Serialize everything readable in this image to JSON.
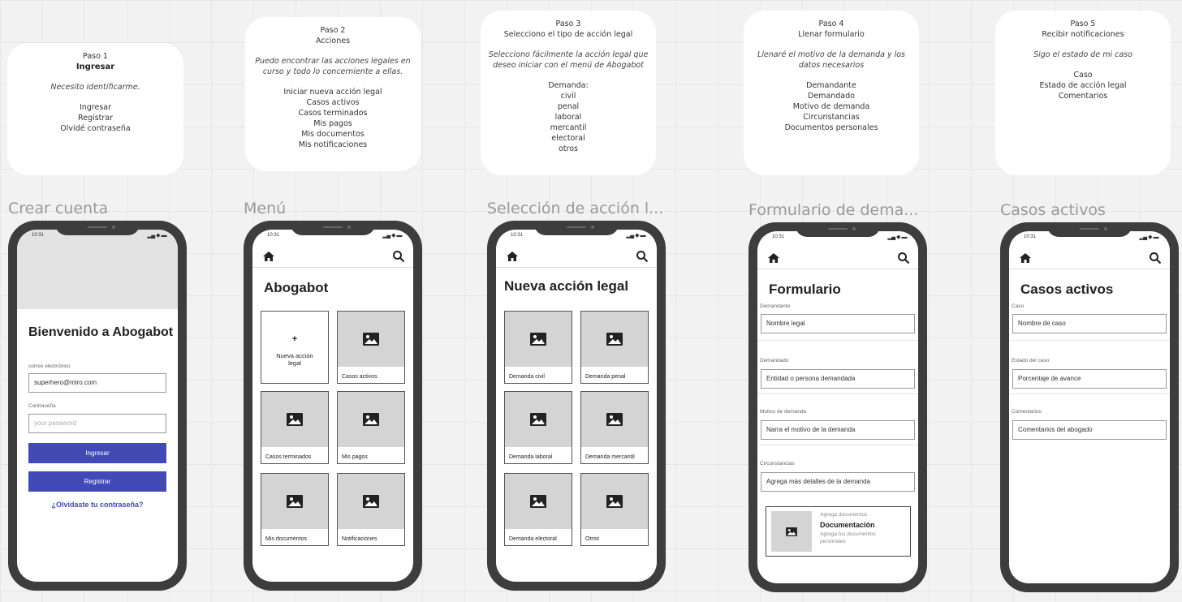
{
  "notes": [
    {
      "step": "Paso 1",
      "title": "Ingresar",
      "desc": "Necesito identificarme.",
      "items": [
        "Ingresar",
        "Registrar",
        "Olvidé contraseña"
      ]
    },
    {
      "step": "Paso 2",
      "title": "Acciones",
      "desc": "Puedo encontrar las acciones legales en curso y todo lo concerniente a ellas.",
      "items": [
        "Iniciar nueva acción legal",
        "Casos activos",
        "Casos terminados",
        "Mis pagos",
        "Mis documentos",
        "Mis notificaciones"
      ]
    },
    {
      "step": "Paso 3",
      "title": "Selecciono el tipo de acción legal",
      "desc": "Selecciono fácilmente la acción legal que deseo iniciar con el menú de Abogabot",
      "items": [
        "Demanda:",
        "civil",
        "penal",
        "laboral",
        "mercantil",
        "electoral",
        "otros"
      ]
    },
    {
      "step": "Paso 4",
      "title": "Llenar formulario",
      "desc": "Llenaré el motivo de la demanda y los datos necesarios",
      "items": [
        "Demandante",
        "Demandado",
        "Motivo de demanda",
        "Circunstancias",
        "Documentos personales"
      ]
    },
    {
      "step": "Paso 5",
      "title": "Recibir notificaciones",
      "desc": "Sigo el estado de mi caso",
      "items": [
        "Caso",
        "Estado de acción legal",
        "Comentarios"
      ]
    }
  ],
  "frames": {
    "crear": {
      "label": "Crear cuenta",
      "clock": "10:31",
      "heading": "Bienvenido a Abogabot",
      "email_label": "correo electrónico",
      "email_value": "superhero@miro.com",
      "password_label": "Contraseña",
      "password_placeholder": "your password",
      "login_button": "Ingresar",
      "register_button": "Registrar",
      "forgot_link": "¿Olvidaste tu contraseña?"
    },
    "menu": {
      "label": "Menú",
      "clock": "10:31",
      "heading": "Abogabot",
      "new_plus": "+",
      "new_label": "Nueva acción legal",
      "tiles": [
        "Casos activos",
        "Casos terminados",
        "Mis pagos",
        "Mis documentos",
        "Notificaciones"
      ]
    },
    "seleccion": {
      "label": "Selección de acción l...",
      "clock": "10:31",
      "heading": "Nueva acción legal",
      "tiles": [
        "Demanda civil",
        "Demanda penal",
        "Demanda laboral",
        "Demanda mercantil",
        "Demanda electoral",
        "Otros"
      ]
    },
    "formulario": {
      "label": "Formulario de dema...",
      "clock": "10:31",
      "heading": "Formulario",
      "fields": [
        {
          "label": "Demandante",
          "value": "Nombre legal"
        },
        {
          "label": "Demandado",
          "value": "Entidad o persona demandada"
        },
        {
          "label": "Motivo de demanda",
          "value": "Narra el motivo de la demanda"
        },
        {
          "label": "Circunstancias",
          "value": "Agrega más detalles de la demanda"
        }
      ],
      "doc_caption": "Agrega documentos",
      "doc_title": "Documentación",
      "doc_desc": "Agrega tus documentos personales"
    },
    "casos": {
      "label": "Casos activos",
      "clock": "10:31",
      "heading": "Casos activos",
      "fields": [
        {
          "label": "Caso",
          "value": "Nombre de caso"
        },
        {
          "label": "Estado del caso",
          "value": "Porcentaje de avance"
        },
        {
          "label": "Comentarios",
          "value": "Comentarios del abogado"
        }
      ]
    }
  }
}
